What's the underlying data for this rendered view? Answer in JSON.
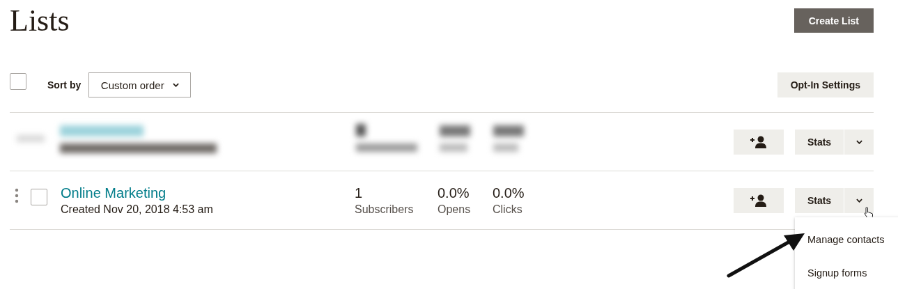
{
  "title": "Lists",
  "create_button": "Create List",
  "toolbar": {
    "select_all": {
      "checked": false
    },
    "sort_label": "Sort by",
    "sort_value": "Custom order",
    "opt_in_button": "Opt-In Settings"
  },
  "rows": [
    {
      "kind": "blurred",
      "stats_button": "Stats",
      "menu_open": false
    },
    {
      "kind": "list",
      "checked": false,
      "name": "Online Marketing",
      "created": "Created Nov 20, 2018 4:53 am",
      "subscribers": "1",
      "subscribers_label": "Subscribers",
      "opens": "0.0%",
      "opens_label": "Opens",
      "clicks": "0.0%",
      "clicks_label": "Clicks",
      "stats_button": "Stats",
      "menu_open": true,
      "menu": [
        "Manage contacts",
        "Signup forms"
      ]
    }
  ]
}
